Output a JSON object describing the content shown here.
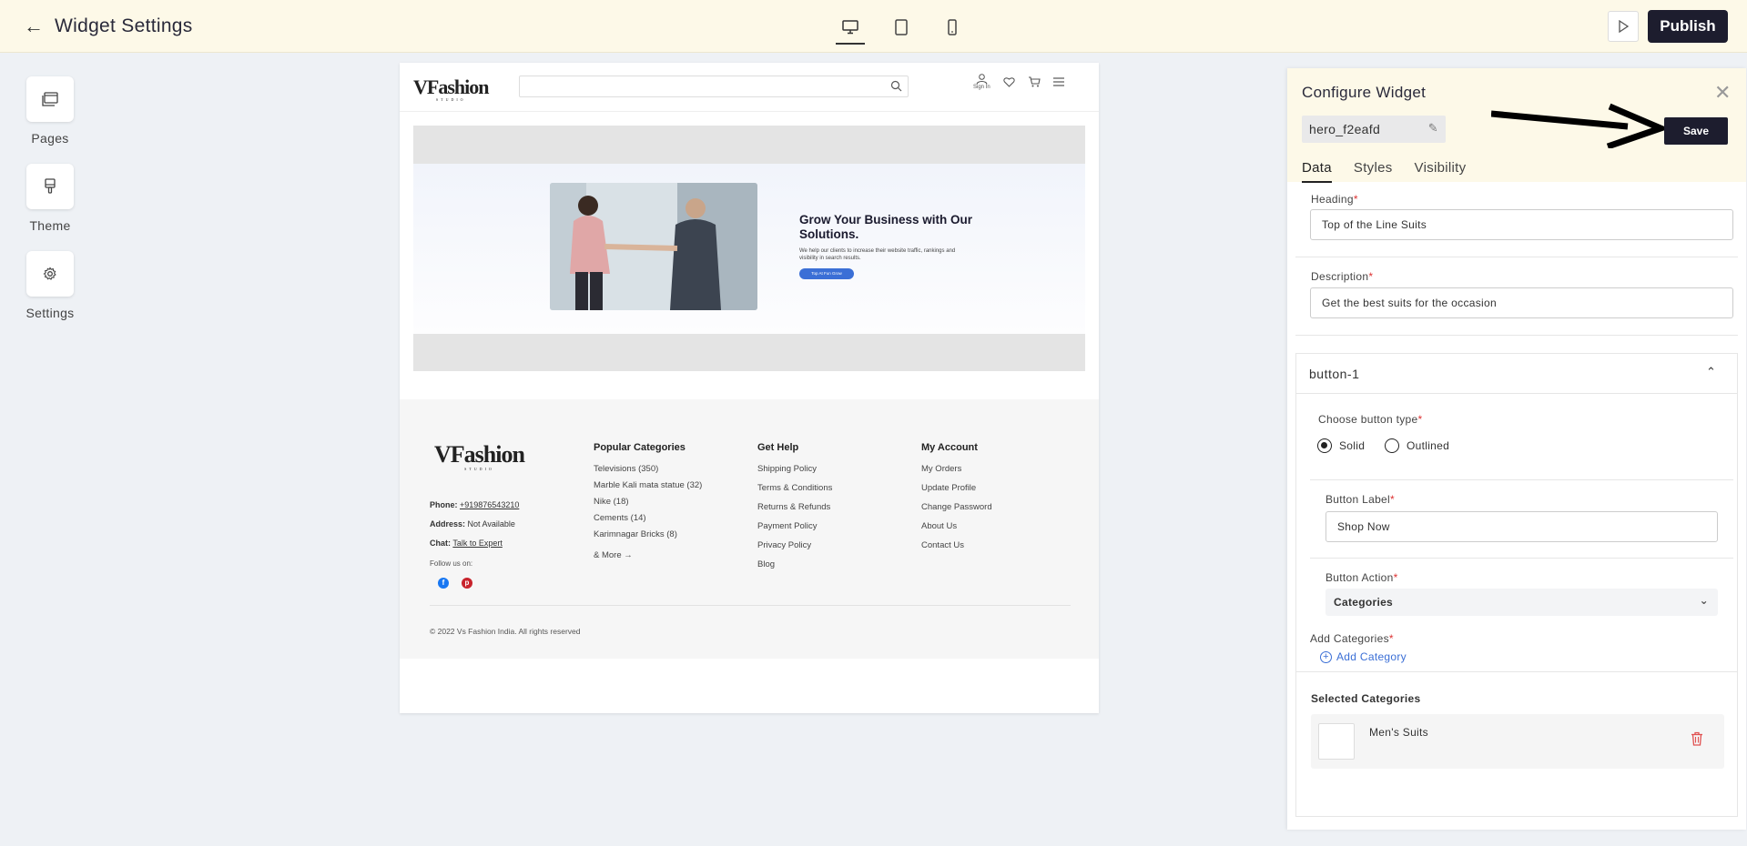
{
  "topbar": {
    "title": "Widget Settings",
    "publish_label": "Publish",
    "devices": [
      "desktop-icon",
      "tablet-icon",
      "mobile-icon"
    ],
    "active_device": "desktop"
  },
  "leftnav": {
    "items": [
      {
        "label": "Pages",
        "icon": "pages-icon"
      },
      {
        "label": "Theme",
        "icon": "theme-icon"
      },
      {
        "label": "Settings",
        "icon": "gear-icon"
      }
    ]
  },
  "preview": {
    "logo": "VFashion",
    "logo_sub": "STUDIO",
    "signin": "Sign In",
    "hero": {
      "heading": "Grow Your Business with Our Solutions.",
      "description": "We help our clients to increase their website traffic, rankings and visibility in search results.",
      "button": "Top At Fun Grow"
    },
    "footer": {
      "phone_label": "Phone:",
      "phone": "+919876543210",
      "address_label": "Address:",
      "address": "Not Available",
      "chat_label": "Chat:",
      "chat": "Talk to Expert",
      "follow": "Follow us on:",
      "copyright": "© 2022 Vs Fashion India. All rights reserved",
      "columns": [
        {
          "title": "Popular Categories",
          "items": [
            "Televisions (350)",
            "Marble Kali mata statue (32)",
            "Nike (18)",
            "Cements (14)",
            "Karimnagar Bricks (8)"
          ],
          "more": "& More →"
        },
        {
          "title": "Get Help",
          "items": [
            "Shipping Policy",
            "Terms & Conditions",
            "Returns & Refunds",
            "Payment Policy",
            "Privacy Policy",
            "Blog"
          ]
        },
        {
          "title": "My Account",
          "items": [
            "My Orders",
            "Update Profile",
            "Change Password",
            "About Us",
            "Contact Us"
          ]
        }
      ]
    }
  },
  "panel": {
    "title": "Configure Widget",
    "widget_id": "hero_f2eafd",
    "save_label": "Save",
    "tabs": [
      "Data",
      "Styles",
      "Visibility"
    ],
    "active_tab": "Data",
    "heading_label": "Heading",
    "heading_value": "Top of the Line Suits",
    "description_label": "Description",
    "description_value": "Get the best suits for the occasion",
    "button": {
      "title": "button-1",
      "type_label": "Choose button type",
      "types": [
        "Solid",
        "Outlined"
      ],
      "selected_type": "Solid",
      "label_label": "Button Label",
      "label_value": "Shop Now",
      "action_label": "Button Action",
      "action_value": "Categories",
      "add_categories_label": "Add Categories",
      "add_category": "Add Category",
      "selected_label": "Selected Categories",
      "selected": [
        "Men's Suits"
      ]
    }
  },
  "colors": {
    "topbar_bg": "#fdf9e8",
    "primary_dark": "#1d1d2e",
    "link_blue": "#3b6fd6",
    "danger": "#e05050"
  }
}
